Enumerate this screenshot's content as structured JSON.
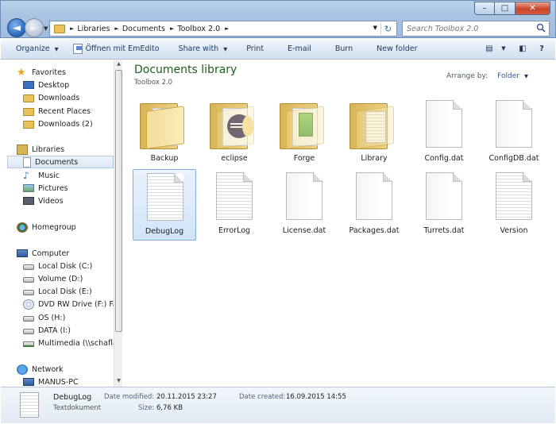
{
  "window": {
    "controls": {
      "min": "–",
      "max": "□",
      "close": "✕"
    }
  },
  "address": {
    "crumbs": [
      "Libraries",
      "Documents",
      "Toolbox 2.0"
    ],
    "refresh": "↻"
  },
  "search": {
    "placeholder": "Search Toolbox 2.0"
  },
  "toolbar": {
    "organize": "Organize",
    "open_with": "Öffnen mit EmEdito",
    "share_with": "Share with",
    "print": "Print",
    "email": "E-mail",
    "burn": "Burn",
    "new_folder": "New folder"
  },
  "nav": {
    "favorites": "Favorites",
    "desktop": "Desktop",
    "downloads": "Downloads",
    "recent_places": "Recent Places",
    "downloads2": "Downloads (2)",
    "libraries": "Libraries",
    "documents": "Documents",
    "music": "Music",
    "pictures": "Pictures",
    "videos": "Videos",
    "homegroup": "Homegroup",
    "computer": "Computer",
    "local_c": "Local Disk (C:)",
    "volume_d": "Volume (D:)",
    "local_e": "Local Disk (E:)",
    "dvd_f": "DVD RW Drive (F:) Fallo",
    "os_h": "OS (H:)",
    "data_i": "DATA (I:)",
    "multimedia": "Multimedia (\\\\schaflan",
    "network": "Network",
    "manus_pc": "MANUS-PC"
  },
  "library": {
    "title": "Documents library",
    "subtitle": "Toolbox 2.0",
    "arrange_label": "Arrange by:",
    "arrange_value": "Folder"
  },
  "items": [
    {
      "name": "Backup",
      "kind": "folder"
    },
    {
      "name": "eclipse",
      "kind": "folder"
    },
    {
      "name": "Forge",
      "kind": "folder"
    },
    {
      "name": "Library",
      "kind": "folder"
    },
    {
      "name": "Config.dat",
      "kind": "file"
    },
    {
      "name": "ConfigDB.dat",
      "kind": "file"
    },
    {
      "name": "DebugLog",
      "kind": "text",
      "selected": true
    },
    {
      "name": "ErrorLog",
      "kind": "text"
    },
    {
      "name": "License.dat",
      "kind": "file"
    },
    {
      "name": "Packages.dat",
      "kind": "file"
    },
    {
      "name": "Turrets.dat",
      "kind": "file"
    },
    {
      "name": "Version",
      "kind": "text"
    }
  ],
  "details": {
    "name": "DebugLog",
    "type": "Textdokument",
    "date_modified_label": "Date modified:",
    "date_modified": "20.11.2015 23:27",
    "date_created_label": "Date created:",
    "date_created": "16.09.2015 14:55",
    "size_label": "Size:",
    "size": "6,76 KB"
  }
}
